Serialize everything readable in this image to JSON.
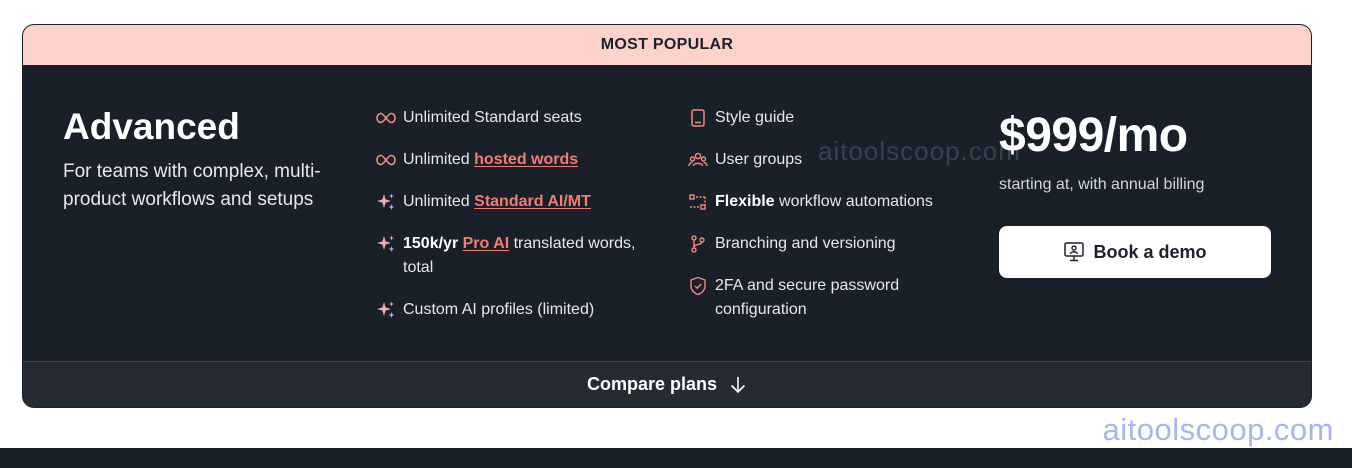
{
  "banner": "MOST POPULAR",
  "plan": {
    "title": "Advanced",
    "description": "For teams with complex, multi-product workflows and setups"
  },
  "features_col1": [
    {
      "icon": "infinity-icon",
      "pre": "Unlimited Standard seats",
      "link": "",
      "post": ""
    },
    {
      "icon": "infinity-icon",
      "pre": "Unlimited ",
      "link": "hosted words",
      "post": ""
    },
    {
      "icon": "sparkle-icon",
      "pre": "Unlimited ",
      "link": "Standard AI/MT",
      "post": ""
    },
    {
      "icon": "sparkle-icon",
      "bold": "150k/yr ",
      "link": "Pro AI",
      "post": " translated words, total"
    },
    {
      "icon": "sparkle-icon",
      "pre": "Custom AI profiles (limited)",
      "link": "",
      "post": ""
    }
  ],
  "features_col2": [
    {
      "icon": "document-icon",
      "pre": "Style guide"
    },
    {
      "icon": "users-icon",
      "pre": "User groups"
    },
    {
      "icon": "workflow-icon",
      "bold": "Flexible",
      "pre": " workflow automations"
    },
    {
      "icon": "branch-icon",
      "pre": "Branching and versioning"
    },
    {
      "icon": "shield-icon",
      "pre": "2FA and secure password configuration"
    }
  ],
  "pricing": {
    "price": "$999/mo",
    "note": "starting at, with annual billing",
    "cta": "Book a demo"
  },
  "footer": {
    "compare": "Compare plans"
  },
  "watermarks": {
    "inner": "aitoolscoop.com",
    "outer": "aitoolscoop.com"
  },
  "colors": {
    "banner": "#fcd2cb",
    "card": "#19202a",
    "accent": "#f47d72",
    "footer": "#262b33"
  }
}
